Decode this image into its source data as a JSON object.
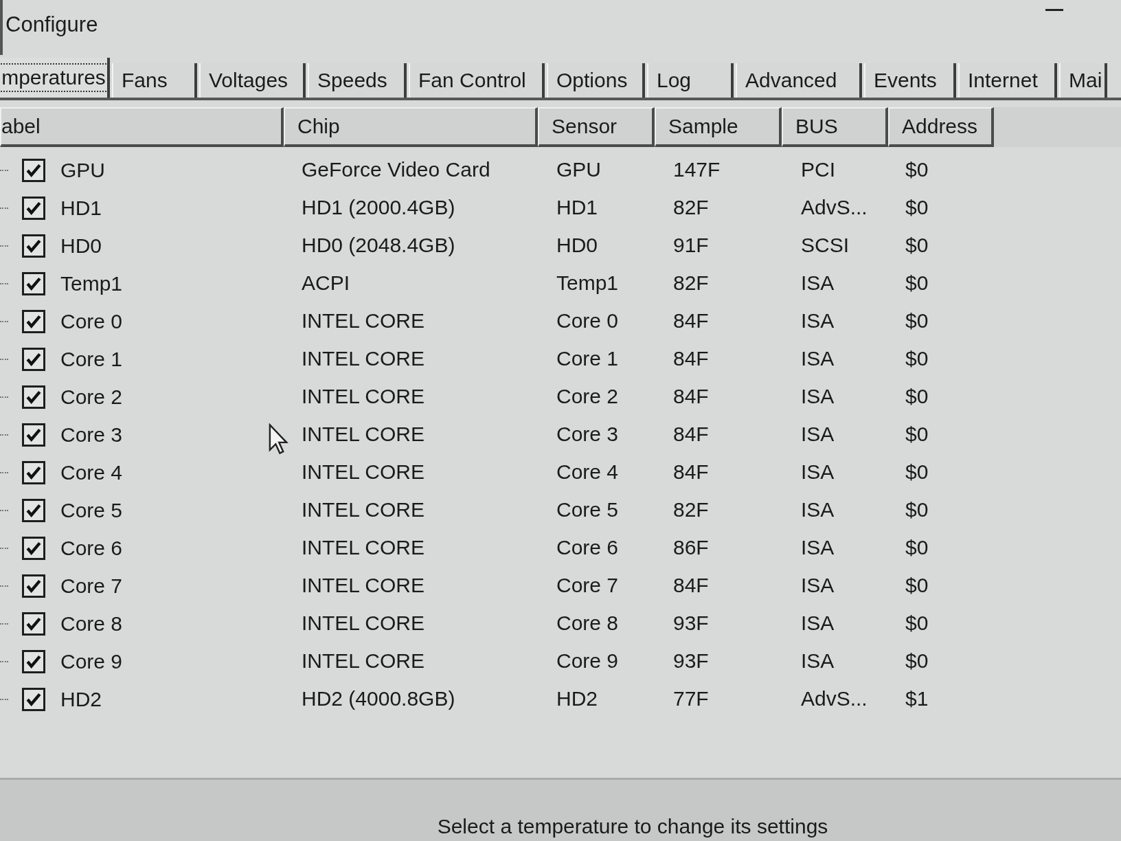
{
  "window": {
    "title": "Configure"
  },
  "tabs": [
    {
      "label": "mperatures",
      "selected": true
    },
    {
      "label": "Fans",
      "selected": false
    },
    {
      "label": "Voltages",
      "selected": false
    },
    {
      "label": "Speeds",
      "selected": false
    },
    {
      "label": "Fan Control",
      "selected": false
    },
    {
      "label": "Options",
      "selected": false
    },
    {
      "label": "Log",
      "selected": false
    },
    {
      "label": "Advanced",
      "selected": false
    },
    {
      "label": "Events",
      "selected": false
    },
    {
      "label": "Internet",
      "selected": false
    },
    {
      "label": "Mai",
      "selected": false
    }
  ],
  "table": {
    "columns": [
      "abel",
      "Chip",
      "Sensor",
      "Sample",
      "BUS",
      "Address"
    ],
    "rows": [
      {
        "checked": true,
        "label": "GPU",
        "chip": "GeForce Video Card",
        "sensor": "GPU",
        "sample": "147F",
        "bus": "PCI",
        "address": "$0"
      },
      {
        "checked": true,
        "label": "HD1",
        "chip": "HD1 (2000.4GB)",
        "sensor": "HD1",
        "sample": "82F",
        "bus": "AdvS...",
        "address": "$0"
      },
      {
        "checked": true,
        "label": "HD0",
        "chip": "HD0 (2048.4GB)",
        "sensor": "HD0",
        "sample": "91F",
        "bus": "SCSI",
        "address": "$0"
      },
      {
        "checked": true,
        "label": "Temp1",
        "chip": "ACPI",
        "sensor": "Temp1",
        "sample": "82F",
        "bus": "ISA",
        "address": "$0"
      },
      {
        "checked": true,
        "label": "Core 0",
        "chip": "INTEL CORE",
        "sensor": "Core 0",
        "sample": "84F",
        "bus": "ISA",
        "address": "$0"
      },
      {
        "checked": true,
        "label": "Core 1",
        "chip": "INTEL CORE",
        "sensor": "Core 1",
        "sample": "84F",
        "bus": "ISA",
        "address": "$0"
      },
      {
        "checked": true,
        "label": "Core 2",
        "chip": "INTEL CORE",
        "sensor": "Core 2",
        "sample": "84F",
        "bus": "ISA",
        "address": "$0"
      },
      {
        "checked": true,
        "label": "Core 3",
        "chip": "INTEL CORE",
        "sensor": "Core 3",
        "sample": "84F",
        "bus": "ISA",
        "address": "$0"
      },
      {
        "checked": true,
        "label": "Core 4",
        "chip": "INTEL CORE",
        "sensor": "Core 4",
        "sample": "84F",
        "bus": "ISA",
        "address": "$0"
      },
      {
        "checked": true,
        "label": "Core 5",
        "chip": "INTEL CORE",
        "sensor": "Core 5",
        "sample": "82F",
        "bus": "ISA",
        "address": "$0"
      },
      {
        "checked": true,
        "label": "Core 6",
        "chip": "INTEL CORE",
        "sensor": "Core 6",
        "sample": "86F",
        "bus": "ISA",
        "address": "$0"
      },
      {
        "checked": true,
        "label": "Core 7",
        "chip": "INTEL CORE",
        "sensor": "Core 7",
        "sample": "84F",
        "bus": "ISA",
        "address": "$0"
      },
      {
        "checked": true,
        "label": "Core 8",
        "chip": "INTEL CORE",
        "sensor": "Core 8",
        "sample": "93F",
        "bus": "ISA",
        "address": "$0"
      },
      {
        "checked": true,
        "label": "Core 9",
        "chip": "INTEL CORE",
        "sensor": "Core 9",
        "sample": "93F",
        "bus": "ISA",
        "address": "$0"
      },
      {
        "checked": true,
        "label": "HD2",
        "chip": "HD2 (4000.8GB)",
        "sensor": "HD2",
        "sample": "77F",
        "bus": "AdvS...",
        "address": "$1"
      }
    ]
  },
  "status_text": "Select a temperature to change its settings"
}
